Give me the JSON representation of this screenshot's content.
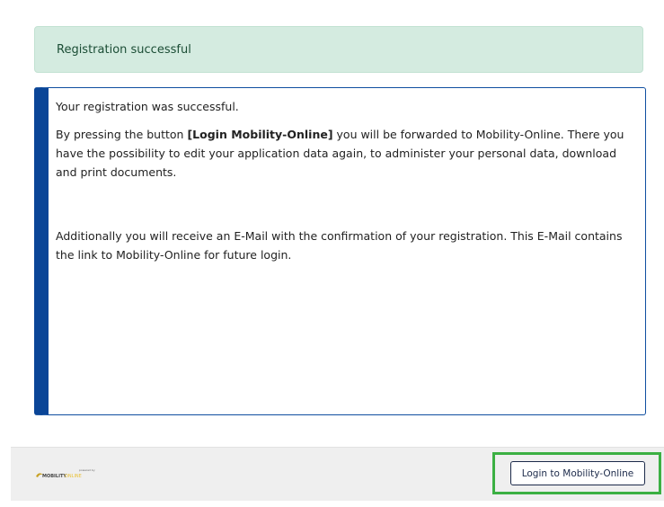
{
  "alert": {
    "text": "Registration successful",
    "color": "#d4ebe0"
  },
  "message": {
    "accent_color": "#0a4597",
    "line1": "Your registration was successful.",
    "p2_prefix": "By pressing the button ",
    "p2_bold": "[Login Mobility-Online]",
    "p2_suffix": " you will be forwarded to Mobility-Online. There you have the possibility to edit your application data again, to administer your personal data, download and print documents.",
    "p3": "Additionally you will receive an E-Mail with the confirmation of your registration. This E-Mail contains the link to Mobility-Online for future login."
  },
  "footer": {
    "logo_icon": "mobility-online-logo",
    "logo_small_text": "powered by",
    "logo_word1": "MOBILITY",
    "logo_word2": "ONLINE",
    "login_button_label": "Login to Mobility-Online",
    "highlight_color": "#3cb043"
  }
}
